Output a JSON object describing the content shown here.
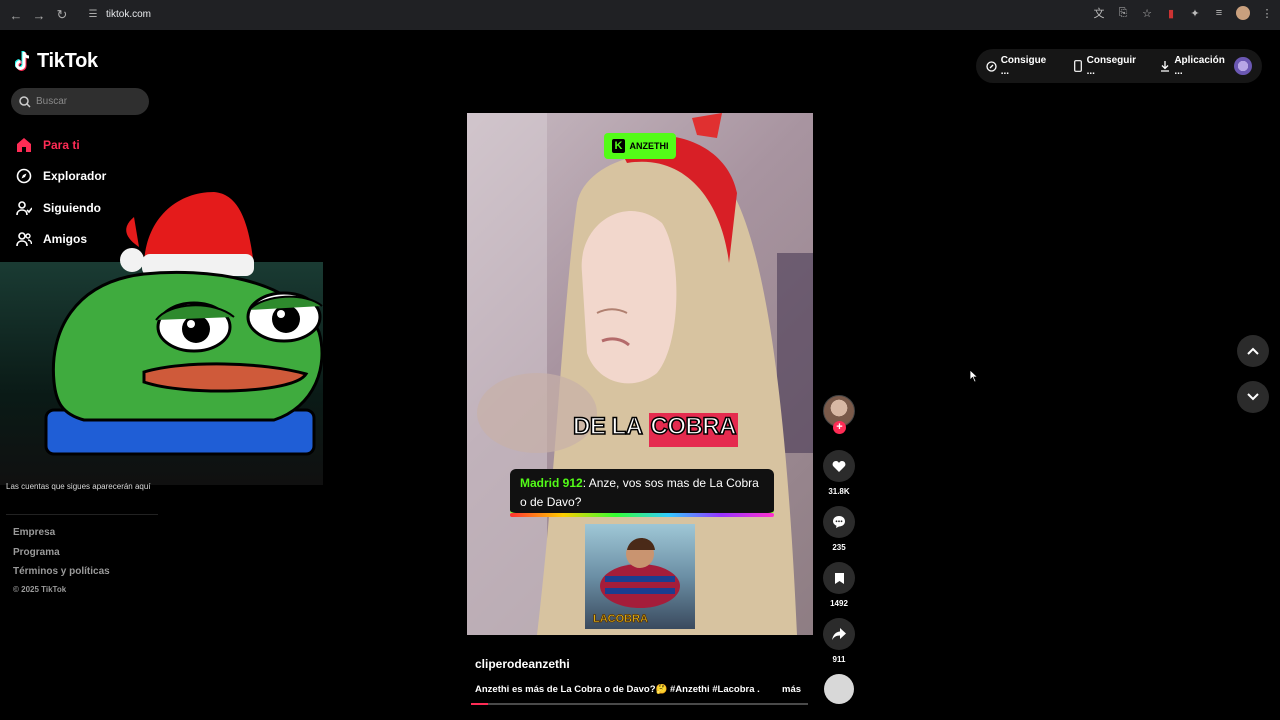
{
  "browser": {
    "url": "tiktok.com"
  },
  "app": {
    "logo_text": "TikTok"
  },
  "search": {
    "placeholder": "Buscar"
  },
  "sidebar": {
    "items": [
      {
        "label": "Para ti",
        "icon": "home-icon",
        "active": true
      },
      {
        "label": "Explorador",
        "icon": "compass-icon",
        "active": false
      },
      {
        "label": "Siguiendo",
        "icon": "following-icon",
        "active": false
      },
      {
        "label": "Amigos",
        "icon": "friends-icon",
        "active": false
      }
    ],
    "following_note": "Las cuentas que sigues aparecerán aquí",
    "footer_links": [
      "Empresa",
      "Programa",
      "Términos y políticas"
    ],
    "copyright": "© 2025 TikTok"
  },
  "video": {
    "badge": "ANZETHI",
    "caption_prefix": "DE LA",
    "caption_highlight": "COBRA",
    "chat_user": "Madrid 912",
    "chat_message": ": Anze, vos sos mas de La Cobra o de Davo?",
    "inset_label": "LACOBRA",
    "author": "cliperodeanzethi",
    "description": "Anzethi es más de La Cobra o de Davo?🤔 #Anzethi #Lacobra ...",
    "more_label": "más",
    "progress": 0.05
  },
  "actions": {
    "likes": "31.8K",
    "comments": "235",
    "saves": "1492",
    "shares": "911",
    "follow_symbol": "+"
  },
  "top_right": {
    "btn1": "Consigue ...",
    "btn2": "Conseguir ...",
    "btn3": "Aplicación ..."
  },
  "colors": {
    "accent": "#fe2c55",
    "kick": "#53fc18"
  }
}
